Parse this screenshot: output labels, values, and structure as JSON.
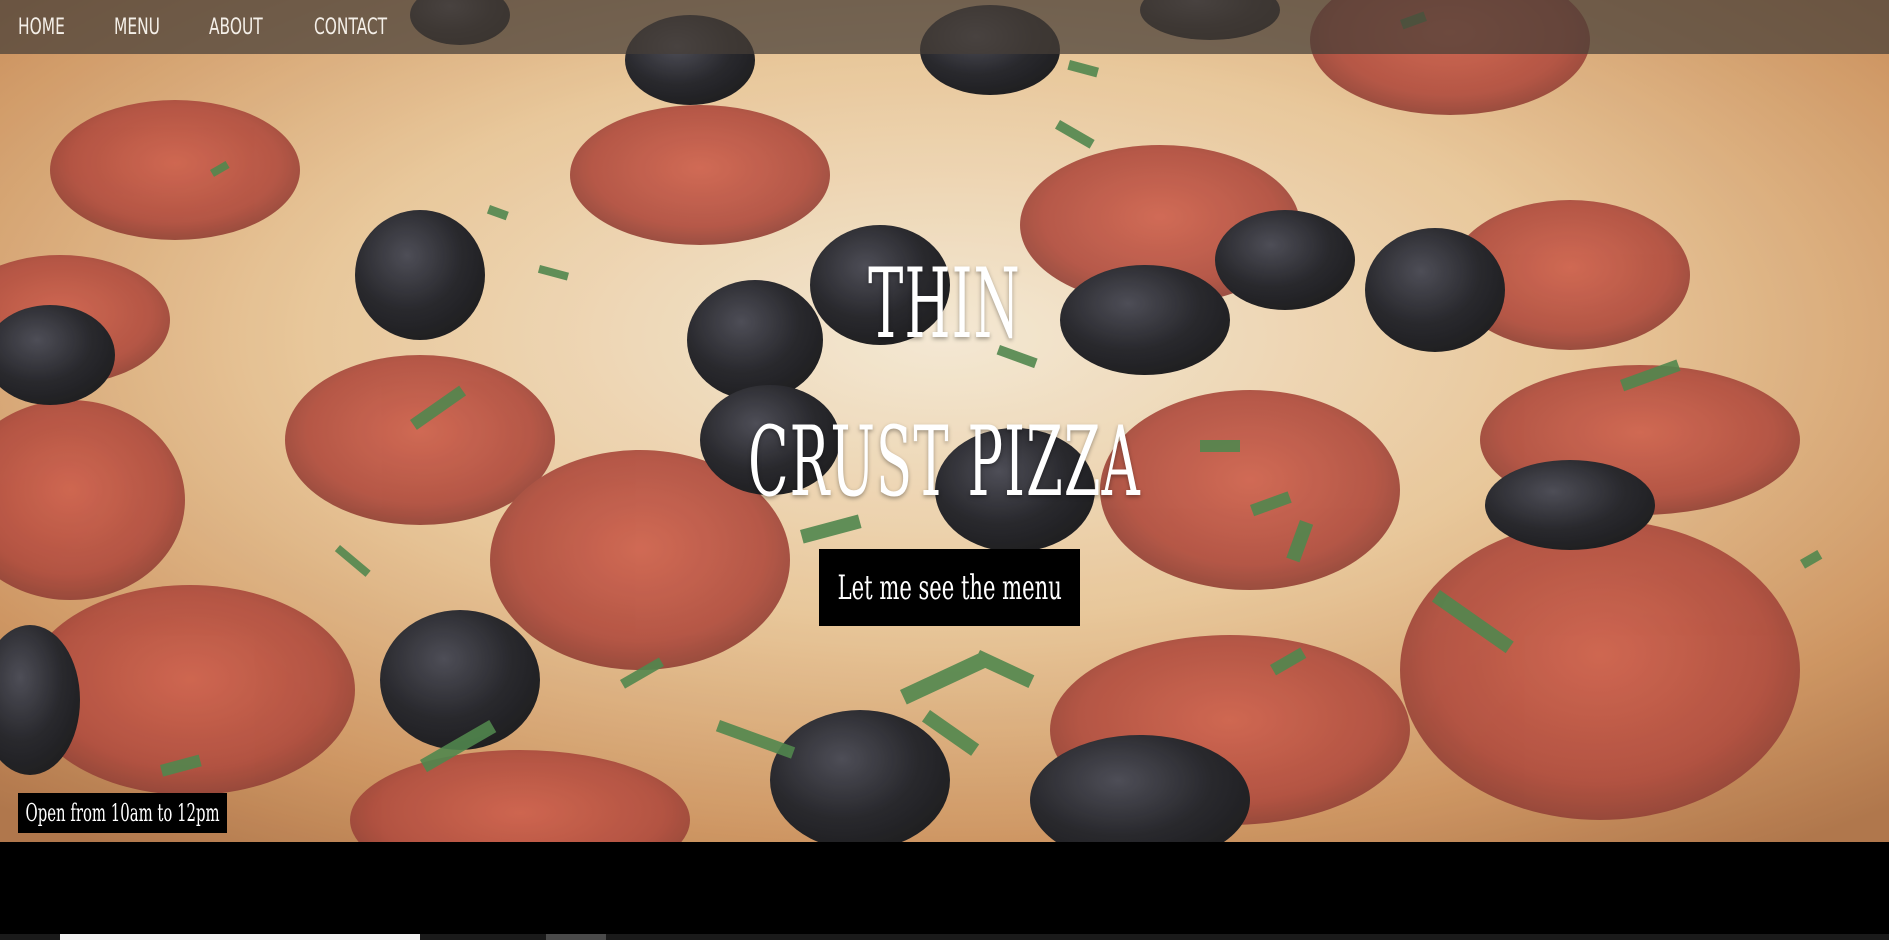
{
  "nav": {
    "items": [
      {
        "label": "HOME"
      },
      {
        "label": "MENU"
      },
      {
        "label": "ABOUT"
      },
      {
        "label": "CONTACT"
      }
    ]
  },
  "hero": {
    "title_line1": "THIN",
    "title_line2": "CRUST PIZZA",
    "cta_label": "Let me see the menu",
    "hours": "Open from 10am to 12pm",
    "background_image": "pizza-photo",
    "overlay_color": "#463e37",
    "button_color": "#000000",
    "text_color": "#ffffff"
  }
}
